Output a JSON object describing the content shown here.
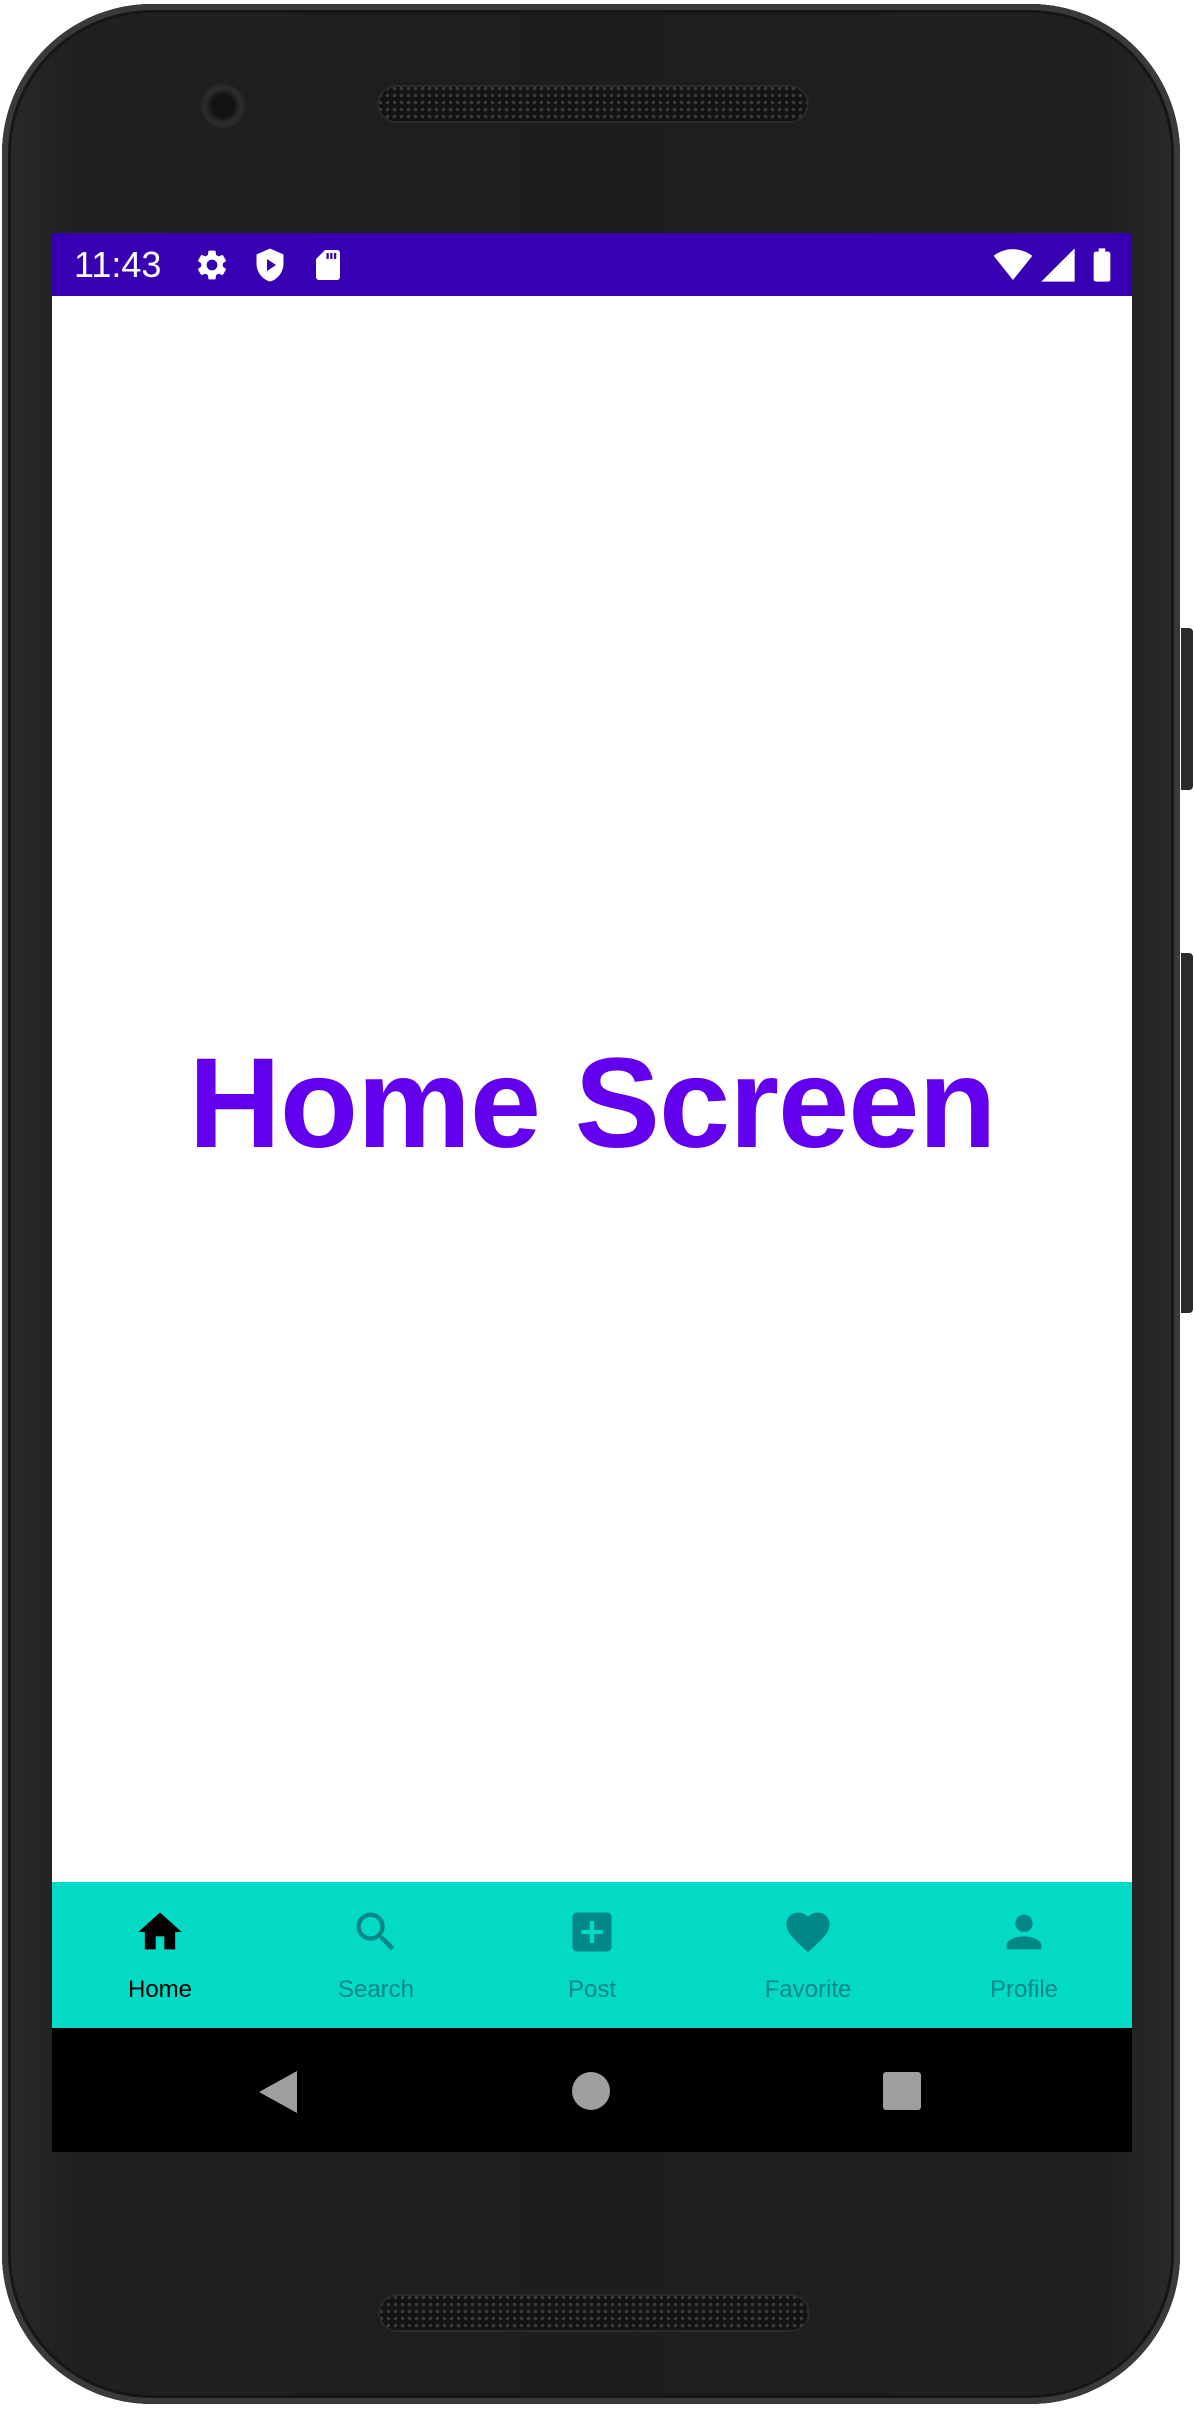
{
  "status_bar": {
    "time": "11:43",
    "background": "#3700b3",
    "left_icons": [
      "settings-gear-icon",
      "shield-play-icon",
      "sd-card-icon"
    ],
    "right_icons": [
      "wifi-icon",
      "cellular-signal-icon",
      "battery-icon"
    ]
  },
  "main": {
    "title": "Home Screen",
    "title_color": "#6200ee"
  },
  "bottom_nav": {
    "background": "#03dac5",
    "active_color": "#000000",
    "inactive_color": "#018786",
    "items": [
      {
        "label": "Home",
        "icon": "home-icon",
        "selected": true
      },
      {
        "label": "Search",
        "icon": "search-icon",
        "selected": false
      },
      {
        "label": "Post",
        "icon": "add-box-icon",
        "selected": false
      },
      {
        "label": "Favorite",
        "icon": "heart-icon",
        "selected": false
      },
      {
        "label": "Profile",
        "icon": "person-icon",
        "selected": false
      }
    ]
  },
  "system_nav": {
    "buttons": [
      "back-icon",
      "home-circle-icon",
      "recents-square-icon"
    ]
  }
}
